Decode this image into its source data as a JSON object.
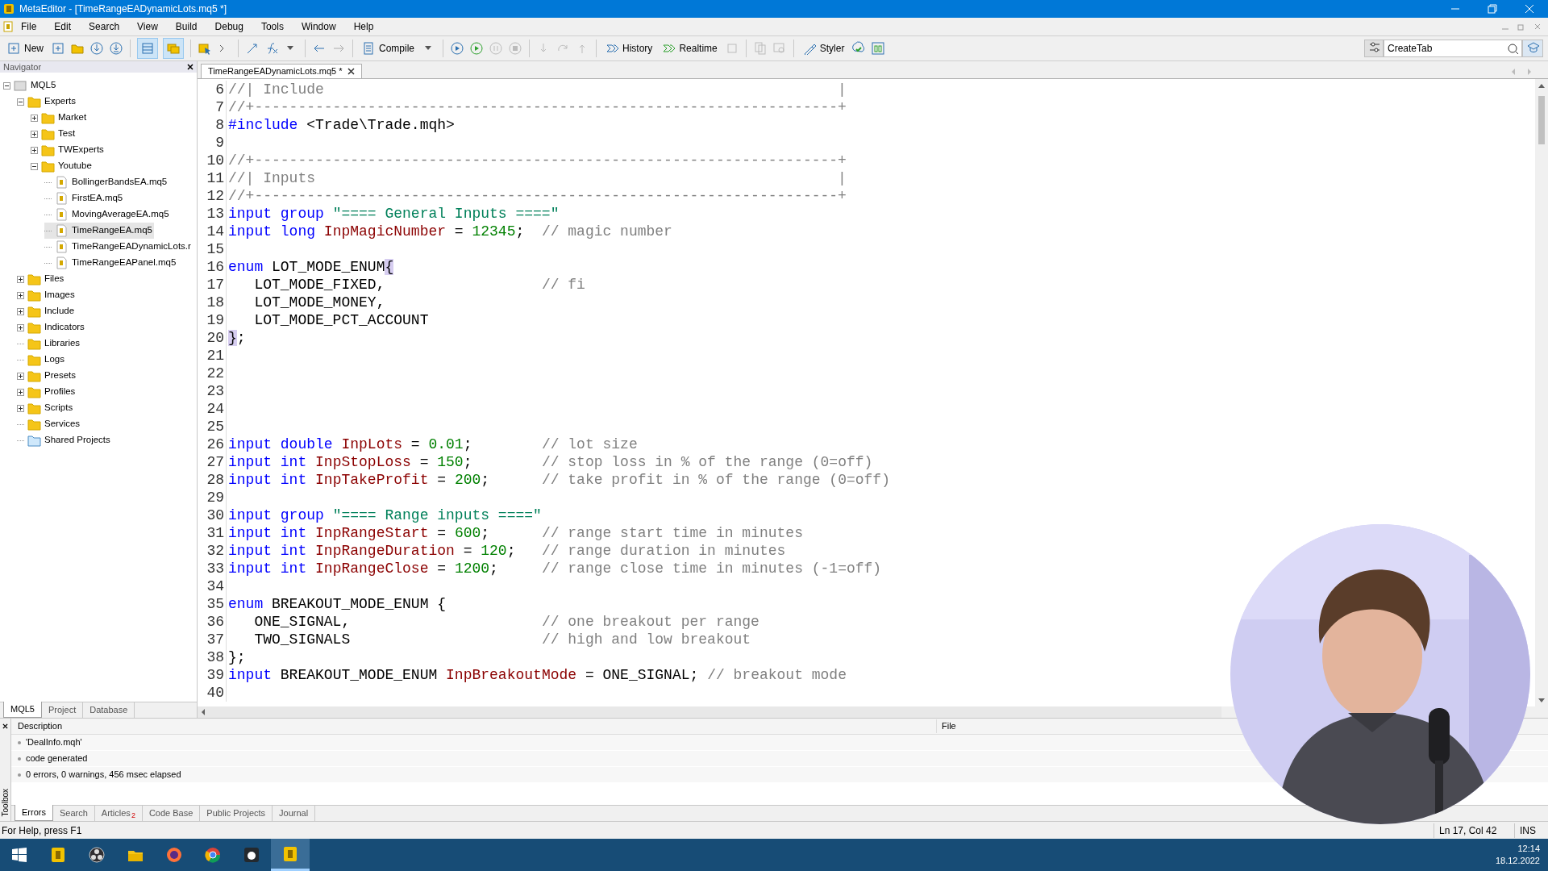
{
  "window": {
    "title": "MetaEditor - [TimeRangeEADynamicLots.mq5 *]"
  },
  "menu": [
    "File",
    "Edit",
    "Search",
    "View",
    "Build",
    "Debug",
    "Tools",
    "Window",
    "Help"
  ],
  "toolbar": {
    "new_button": "New",
    "compile_button": "Compile",
    "history_button": "History",
    "realtime_button": "Realtime",
    "styler_button": "Styler",
    "search": {
      "value": "CreateTab"
    },
    "toggles": [
      {
        "on": true
      },
      {
        "on": true
      }
    ]
  },
  "navigator": {
    "title": "Navigator",
    "tree": [
      {
        "label": "MQL5",
        "kind": "root",
        "expandable": true,
        "expanded": true,
        "selected": false,
        "children": [
          {
            "label": "Experts",
            "kind": "folder",
            "expandable": true,
            "expanded": true,
            "selected": false,
            "children": [
              {
                "label": "Market",
                "kind": "folder",
                "expandable": true,
                "expanded": false,
                "selected": false
              },
              {
                "label": "Test",
                "kind": "folder",
                "expandable": true,
                "expanded": false,
                "selected": false
              },
              {
                "label": "TWExperts",
                "kind": "folder",
                "expandable": true,
                "expanded": false,
                "selected": false
              },
              {
                "label": "Youtube",
                "kind": "folder",
                "expandable": true,
                "expanded": true,
                "selected": false,
                "children": [
                  {
                    "label": "BollingerBandsEA.mq5",
                    "kind": "file",
                    "expandable": false,
                    "selected": false
                  },
                  {
                    "label": "FirstEA.mq5",
                    "kind": "file",
                    "expandable": false,
                    "selected": false
                  },
                  {
                    "label": "MovingAverageEA.mq5",
                    "kind": "file",
                    "expandable": false,
                    "selected": false
                  },
                  {
                    "label": "TimeRangeEA.mq5",
                    "kind": "file",
                    "expandable": false,
                    "selected": true
                  },
                  {
                    "label": "TimeRangeEADynamicLots.r",
                    "kind": "file",
                    "expandable": false,
                    "selected": false
                  },
                  {
                    "label": "TimeRangeEAPanel.mq5",
                    "kind": "file",
                    "expandable": false,
                    "selected": false
                  }
                ]
              }
            ]
          },
          {
            "label": "Files",
            "kind": "folder",
            "expandable": true,
            "expanded": false,
            "selected": false
          },
          {
            "label": "Images",
            "kind": "folder",
            "expandable": true,
            "expanded": false,
            "selected": false
          },
          {
            "label": "Include",
            "kind": "folder",
            "expandable": true,
            "expanded": false,
            "selected": false
          },
          {
            "label": "Indicators",
            "kind": "folder",
            "expandable": true,
            "expanded": false,
            "selected": false
          },
          {
            "label": "Libraries",
            "kind": "folder",
            "expandable": false,
            "selected": false
          },
          {
            "label": "Logs",
            "kind": "folder",
            "expandable": false,
            "selected": false
          },
          {
            "label": "Presets",
            "kind": "folder",
            "expandable": true,
            "expanded": false,
            "selected": false
          },
          {
            "label": "Profiles",
            "kind": "folder",
            "expandable": true,
            "expanded": false,
            "selected": false
          },
          {
            "label": "Scripts",
            "kind": "folder",
            "expandable": true,
            "expanded": false,
            "selected": false
          },
          {
            "label": "Services",
            "kind": "folder",
            "expandable": false,
            "selected": false
          },
          {
            "label": "Shared Projects",
            "kind": "shared",
            "expandable": false,
            "selected": false
          }
        ]
      }
    ],
    "tabs": [
      {
        "label": "MQL5",
        "selected": true
      },
      {
        "label": "Project",
        "selected": false
      },
      {
        "label": "Database",
        "selected": false
      }
    ]
  },
  "editor": {
    "tab": {
      "label": "TimeRangeEADynamicLots.mq5 *",
      "selected": true
    },
    "lines": [
      {
        "number": "6",
        "tokens": [
          {
            "kind": "comment",
            "text": "//| Include                                                           |"
          }
        ]
      },
      {
        "number": "7",
        "tokens": [
          {
            "kind": "comment",
            "text": "//+-------------------------------------------------------------------+"
          }
        ]
      },
      {
        "number": "8",
        "tokens": [
          {
            "kind": "preprocessor",
            "text": "#include"
          },
          {
            "kind": "plain",
            "text": " <Trade\\Trade.mqh>"
          }
        ]
      },
      {
        "number": "9"
      },
      {
        "number": "10",
        "tokens": [
          {
            "kind": "comment",
            "text": "//+-------------------------------------------------------------------+"
          }
        ]
      },
      {
        "number": "11",
        "tokens": [
          {
            "kind": "comment",
            "text": "//| Inputs                                                            |"
          }
        ]
      },
      {
        "number": "12",
        "tokens": [
          {
            "kind": "comment",
            "text": "//+-------------------------------------------------------------------+"
          }
        ]
      },
      {
        "number": "13",
        "tokens": [
          {
            "kind": "keyword",
            "text": "input group "
          },
          {
            "kind": "string",
            "text": "\"==== General Inputs ====\""
          }
        ]
      },
      {
        "number": "14",
        "tokens": [
          {
            "kind": "keyword",
            "text": "input long "
          },
          {
            "kind": "identifier",
            "text": "InpMagicNumber"
          },
          {
            "kind": "plain",
            "text": " = "
          },
          {
            "kind": "number",
            "text": "12345"
          },
          {
            "kind": "plain",
            "text": ";  "
          },
          {
            "kind": "comment",
            "text": "// magic number"
          }
        ]
      },
      {
        "number": "15"
      },
      {
        "number": "16",
        "tokens": [
          {
            "kind": "keyword",
            "text": "enum"
          },
          {
            "kind": "plain",
            "text": " LOT_MODE_ENUM"
          },
          {
            "kind": "bracket",
            "text": "{"
          }
        ]
      },
      {
        "number": "17",
        "tokens": [
          {
            "kind": "plain",
            "text": "   LOT_MODE_FIXED,                  "
          },
          {
            "kind": "comment",
            "text": "// fi"
          }
        ]
      },
      {
        "number": "18",
        "tokens": [
          {
            "kind": "plain",
            "text": "   LOT_MODE_MONEY,"
          }
        ]
      },
      {
        "number": "19",
        "tokens": [
          {
            "kind": "plain",
            "text": "   LOT_MODE_PCT_ACCOUNT"
          }
        ]
      },
      {
        "number": "20",
        "tokens": [
          {
            "kind": "bracket",
            "text": "}"
          },
          {
            "kind": "plain",
            "text": ";"
          }
        ]
      },
      {
        "number": "21"
      },
      {
        "number": "22"
      },
      {
        "number": "23"
      },
      {
        "number": "24"
      },
      {
        "number": "25"
      },
      {
        "number": "26",
        "tokens": [
          {
            "kind": "keyword",
            "text": "input double "
          },
          {
            "kind": "identifier",
            "text": "InpLots"
          },
          {
            "kind": "plain",
            "text": " = "
          },
          {
            "kind": "number",
            "text": "0.01"
          },
          {
            "kind": "plain",
            "text": ";        "
          },
          {
            "kind": "comment",
            "text": "// lot size"
          }
        ]
      },
      {
        "number": "27",
        "tokens": [
          {
            "kind": "keyword",
            "text": "input int "
          },
          {
            "kind": "identifier",
            "text": "InpStopLoss"
          },
          {
            "kind": "plain",
            "text": " = "
          },
          {
            "kind": "number",
            "text": "150"
          },
          {
            "kind": "plain",
            "text": ";        "
          },
          {
            "kind": "comment",
            "text": "// stop loss in % of the range (0=off)"
          }
        ]
      },
      {
        "number": "28",
        "tokens": [
          {
            "kind": "keyword",
            "text": "input int "
          },
          {
            "kind": "identifier",
            "text": "InpTakeProfit"
          },
          {
            "kind": "plain",
            "text": " = "
          },
          {
            "kind": "number",
            "text": "200"
          },
          {
            "kind": "plain",
            "text": ";      "
          },
          {
            "kind": "comment",
            "text": "// take profit in % of the range (0=off)"
          }
        ]
      },
      {
        "number": "29"
      },
      {
        "number": "30",
        "tokens": [
          {
            "kind": "keyword",
            "text": "input group "
          },
          {
            "kind": "string",
            "text": "\"==== Range inputs ====\""
          }
        ]
      },
      {
        "number": "31",
        "tokens": [
          {
            "kind": "keyword",
            "text": "input int "
          },
          {
            "kind": "identifier",
            "text": "InpRangeStart"
          },
          {
            "kind": "plain",
            "text": " = "
          },
          {
            "kind": "number",
            "text": "600"
          },
          {
            "kind": "plain",
            "text": ";      "
          },
          {
            "kind": "comment",
            "text": "// range start time in minutes"
          }
        ]
      },
      {
        "number": "32",
        "tokens": [
          {
            "kind": "keyword",
            "text": "input int "
          },
          {
            "kind": "identifier",
            "text": "InpRangeDuration"
          },
          {
            "kind": "plain",
            "text": " = "
          },
          {
            "kind": "number",
            "text": "120"
          },
          {
            "kind": "plain",
            "text": ";   "
          },
          {
            "kind": "comment",
            "text": "// range duration in minutes"
          }
        ]
      },
      {
        "number": "33",
        "tokens": [
          {
            "kind": "keyword",
            "text": "input int "
          },
          {
            "kind": "identifier",
            "text": "InpRangeClose"
          },
          {
            "kind": "plain",
            "text": " = "
          },
          {
            "kind": "number",
            "text": "1200"
          },
          {
            "kind": "plain",
            "text": ";     "
          },
          {
            "kind": "comment",
            "text": "// range close time in minutes (-1=off)"
          }
        ]
      },
      {
        "number": "34"
      },
      {
        "number": "35",
        "tokens": [
          {
            "kind": "keyword",
            "text": "enum"
          },
          {
            "kind": "plain",
            "text": " BREAKOUT_MODE_ENUM {"
          }
        ]
      },
      {
        "number": "36",
        "tokens": [
          {
            "kind": "plain",
            "text": "   ONE_SIGNAL,                      "
          },
          {
            "kind": "comment",
            "text": "// one breakout per range"
          }
        ]
      },
      {
        "number": "37",
        "tokens": [
          {
            "kind": "plain",
            "text": "   TWO_SIGNALS                      "
          },
          {
            "kind": "comment",
            "text": "// high and low breakout"
          }
        ]
      },
      {
        "number": "38",
        "tokens": [
          {
            "kind": "plain",
            "text": "};"
          }
        ]
      },
      {
        "number": "39",
        "tokens": [
          {
            "kind": "keyword",
            "text": "input"
          },
          {
            "kind": "plain",
            "text": " BREAKOUT_MODE_ENUM "
          },
          {
            "kind": "identifier",
            "text": "InpBreakoutMode"
          },
          {
            "kind": "plain",
            "text": " = ONE_SIGNAL; "
          },
          {
            "kind": "comment",
            "text": "// breakout mode"
          }
        ]
      },
      {
        "number": "40"
      }
    ]
  },
  "toolbox": {
    "title": "Toolbox",
    "columns": [
      "Description",
      "File"
    ],
    "rows": [
      "'DealInfo.mqh'",
      "code generated",
      "0 errors, 0 warnings, 456 msec elapsed"
    ],
    "tabs": [
      {
        "label": "Errors",
        "selected": true
      },
      {
        "label": "Search",
        "selected": false
      },
      {
        "label": "Articles",
        "badge": "2",
        "selected": false
      },
      {
        "label": "Code Base",
        "selected": false
      },
      {
        "label": "Public Projects",
        "selected": false
      },
      {
        "label": "Journal",
        "selected": false
      }
    ]
  },
  "status_bar": {
    "help": "For Help, press F1",
    "position": "Ln 17, Col 42",
    "mode": "INS"
  },
  "taskbar": {
    "apps": [
      {
        "active": false
      },
      {
        "active": false
      },
      {
        "active": false
      },
      {
        "active": false
      },
      {
        "active": false
      },
      {
        "active": false
      },
      {
        "active": true
      }
    ],
    "time": "12:14",
    "date": "18.12.2022"
  }
}
